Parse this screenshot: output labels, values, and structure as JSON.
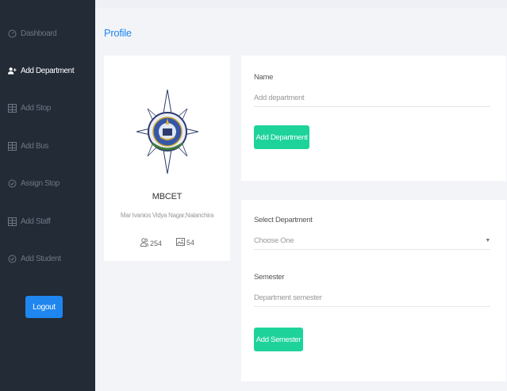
{
  "sidebar": {
    "items": [
      {
        "label": "Dashboard",
        "icon": "dashboard-icon",
        "active": false
      },
      {
        "label": "Add Department",
        "icon": "add-user-icon",
        "active": true
      },
      {
        "label": "Add Stop",
        "icon": "table-icon",
        "active": false
      },
      {
        "label": "Add Bus",
        "icon": "table-icon",
        "active": false
      },
      {
        "label": "Assign Stop",
        "icon": "circle-check-icon",
        "active": false
      },
      {
        "label": "Add Staff",
        "icon": "table-icon",
        "active": false
      },
      {
        "label": "Add Student",
        "icon": "circle-check-icon",
        "active": false
      }
    ],
    "logout_label": "Logout"
  },
  "page": {
    "title": "Profile"
  },
  "profile": {
    "name": "MBCET",
    "address": "Mar Ivanios Vidya Nagar,Nalanchira",
    "stats": {
      "people": "254",
      "images": "54"
    }
  },
  "department_form": {
    "name_label": "Name",
    "name_placeholder": "Add department",
    "button_label": "Add Department"
  },
  "semester_form": {
    "department_label": "Select Department",
    "department_selected": "Choose One",
    "semester_label": "Semester",
    "semester_placeholder": "Department semester",
    "button_label": "Add Semester"
  },
  "colors": {
    "sidebar_bg": "#222b36",
    "accent_blue": "#1f86f0",
    "accent_green": "#1ed39a"
  }
}
